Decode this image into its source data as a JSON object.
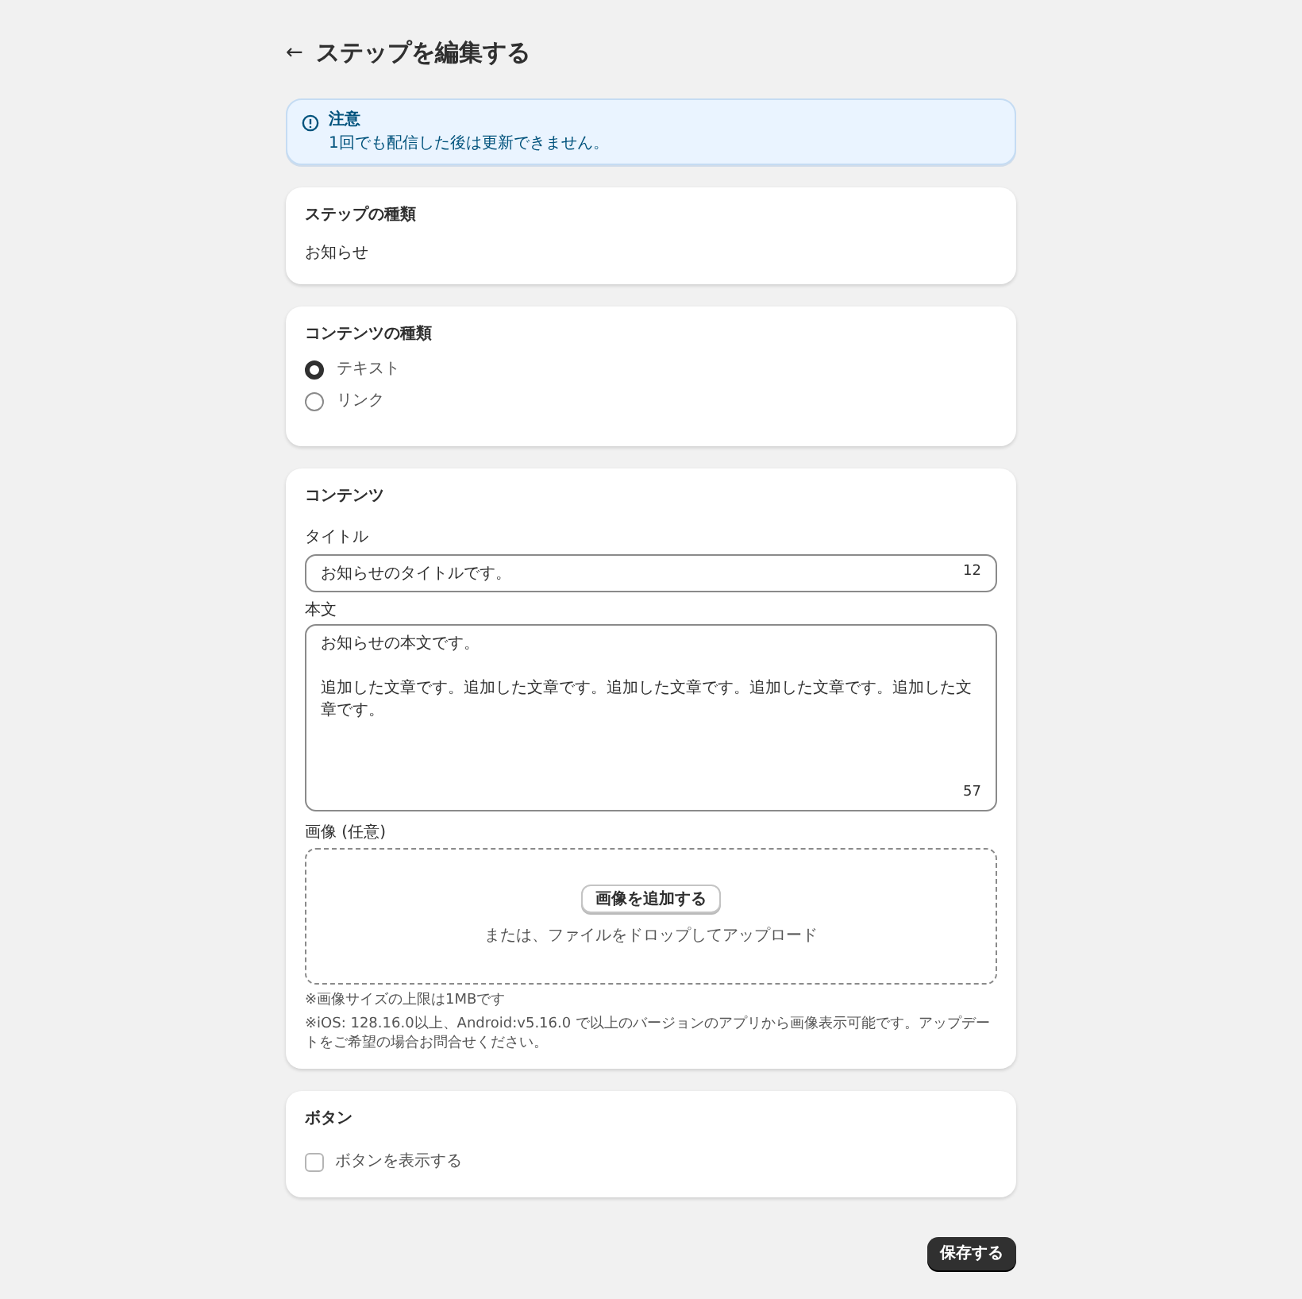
{
  "header": {
    "back_icon": "←",
    "title": "ステップを編集する"
  },
  "notice": {
    "title": "注意",
    "message": "1回でも配信した後は更新できません。"
  },
  "step_type": {
    "heading": "ステップの種類",
    "value": "お知らせ"
  },
  "content_type": {
    "heading": "コンテンツの種類",
    "options": [
      {
        "label": "テキスト",
        "selected": true
      },
      {
        "label": "リンク",
        "selected": false
      }
    ]
  },
  "content": {
    "heading": "コンテンツ",
    "title_field": {
      "label": "タイトル",
      "value": "お知らせのタイトルです。",
      "count": "12"
    },
    "body_field": {
      "label": "本文",
      "paragraphs": [
        "お知らせの本文です。",
        "追加した文章です。追加した文章です。追加した文章です。追加した文章です。追加した文章です。"
      ],
      "count": "57"
    },
    "image": {
      "label": "画像 (任意)",
      "button": "画像を追加する",
      "hint": "または、ファイルをドロップしてアップロード"
    },
    "notes": [
      "※画像サイズの上限は1MBです",
      "※iOS: 128.16.0以上、Android:v5.16.0 で以上のバージョンのアプリから画像表示可能です。アップデートをご希望の場合お問合せください。"
    ]
  },
  "button_section": {
    "heading": "ボタン",
    "checkbox": {
      "label": "ボタンを表示する",
      "checked": false
    }
  },
  "save_button": "保存する"
}
